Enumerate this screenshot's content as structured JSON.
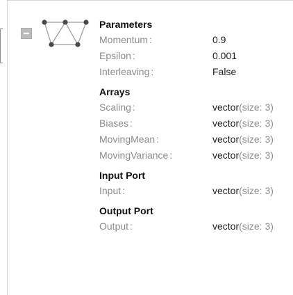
{
  "node": {
    "collapse_state": "expanded",
    "icon": "neural-network-icon"
  },
  "sections": [
    {
      "title": "Parameters",
      "rows": [
        {
          "key": "Momentum",
          "value": "0.9"
        },
        {
          "key": "Epsilon",
          "value": "0.001"
        },
        {
          "key": "Interleaving",
          "value": "False"
        }
      ]
    },
    {
      "title": "Arrays",
      "rows": [
        {
          "key": "Scaling",
          "value": "vector",
          "hint": "(size: 3)"
        },
        {
          "key": "Biases",
          "value": "vector",
          "hint": "(size: 3)"
        },
        {
          "key": "MovingMean",
          "value": "vector",
          "hint": "(size: 3)"
        },
        {
          "key": "MovingVariance",
          "value": "vector",
          "hint": "(size: 3)"
        }
      ]
    },
    {
      "title": "Input Port",
      "rows": [
        {
          "key": "Input",
          "value": "vector",
          "hint": "(size: 3)"
        }
      ]
    },
    {
      "title": "Output Port",
      "rows": [
        {
          "key": "Output",
          "value": "vector",
          "hint": "(size: 3)"
        }
      ]
    }
  ]
}
